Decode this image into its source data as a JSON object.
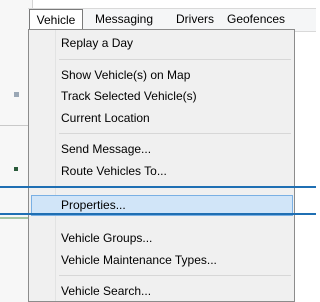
{
  "menubar": {
    "items": [
      "Vehicle",
      "Messaging",
      "Drivers",
      "Geofences"
    ]
  },
  "vehicle_menu": {
    "replay_a_day": "Replay a Day",
    "show_vehicles_on_map": "Show Vehicle(s) on Map",
    "track_selected_vehicles": "Track Selected Vehicle(s)",
    "current_location": "Current Location",
    "send_message": "Send Message...",
    "route_vehicles_to": "Route Vehicles To...",
    "properties": "Properties...",
    "vehicle_groups": "Vehicle Groups...",
    "vehicle_maintenance_types": "Vehicle Maintenance Types...",
    "vehicle_search": "Vehicle Search..."
  },
  "colors": {
    "highlight_fill": "#d1e5f8",
    "highlight_border": "#7ab0e4",
    "guide_line": "#1f6fb3"
  }
}
